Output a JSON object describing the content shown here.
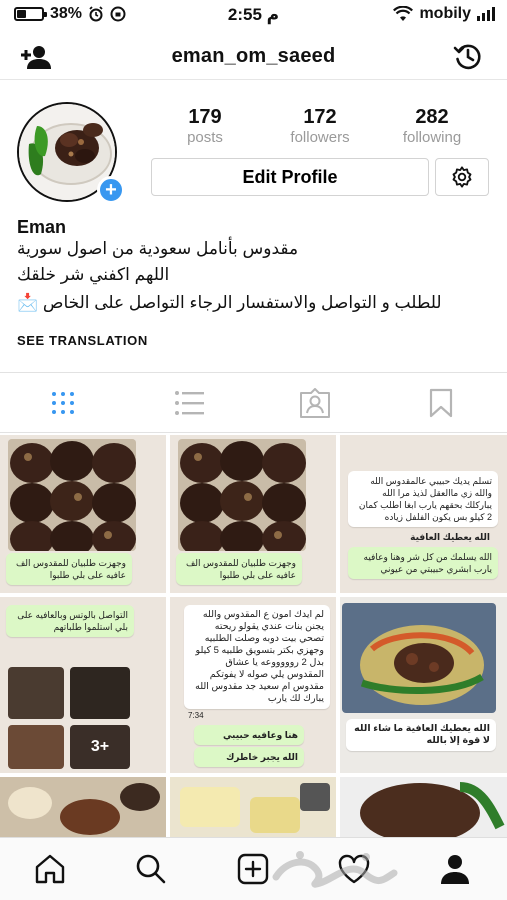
{
  "status_bar": {
    "battery": "38%",
    "battery_level": 0.38,
    "time": "2:55 م",
    "carrier": "mobily"
  },
  "header": {
    "username": "eman_om_saeed",
    "add_user_icon": "add-person-icon",
    "history_icon": "history-icon"
  },
  "profile": {
    "add_story_label": "+",
    "stats": [
      {
        "value": "179",
        "label": "posts"
      },
      {
        "value": "172",
        "label": "followers"
      },
      {
        "value": "282",
        "label": "following"
      }
    ],
    "edit_profile_label": "Edit Profile",
    "settings_icon": "gear-icon"
  },
  "bio": {
    "name": "Eman",
    "lines": [
      "مقدوس بأنامل سعودية من اصول سورية",
      "اللهم اكفني شر خلقك",
      "للطلب و التواصل والاستفسار الرجاء التواصل على الخاص 📩"
    ],
    "see_translation": "SEE TRANSLATION"
  },
  "tabs": [
    "grid-icon",
    "list-icon",
    "tagged-icon",
    "bookmark-icon"
  ],
  "grid": {
    "post1_caption": "وجهزت طلبيان للمقدوس الف عافيه على بلي طلبوا",
    "post2_caption": "وجهزت طلبيان للمقدوس الف عافيه على بلي طلبوا",
    "post3_top": "تسلم يديك حبيبي عالمقدوس الله والله زي ماالعقل لذيذ مرا الله يباركلك بحقهم يارب ابغا اطلب كمان 2 كيلو بس يكون الفلفل زياده",
    "post3_reply": "الله يعطيك العافية",
    "post3_bottom": "الله يسلمك من كل شر وهنا وعافيه يارب ابشري حبيبتي من عيوني",
    "post4_text": "التواصل بالوتس وبالعافيه على بلي استلموا طلباتهم",
    "post4_more": "3+",
    "post5_text": "لم ايدك امون ع المقدوس والله يجنن بنات عندي يقولو ريحته تصحي بيت دوبه وصلت الطلبيه وجهزي بكتر بتسويق طلبيه 5 كيلو بدل 2 روووووعه يا عشاق المقدوس يلي صوله لا يفوتكم مقدوس ام سعيد جد مقدوس الله يبارك لك يارب",
    "post5_time": "7:34",
    "post5_reply1": "هنا وعافيه حبيبي",
    "post5_reply2": "الله يجبر خاطرك",
    "post6_text": "الله يعطيك العافية ما شاء الله لا قوة إلا بالله"
  },
  "bottom_nav": [
    "home-icon",
    "search-icon",
    "new-post-icon",
    "activity-icon",
    "profile-icon"
  ]
}
